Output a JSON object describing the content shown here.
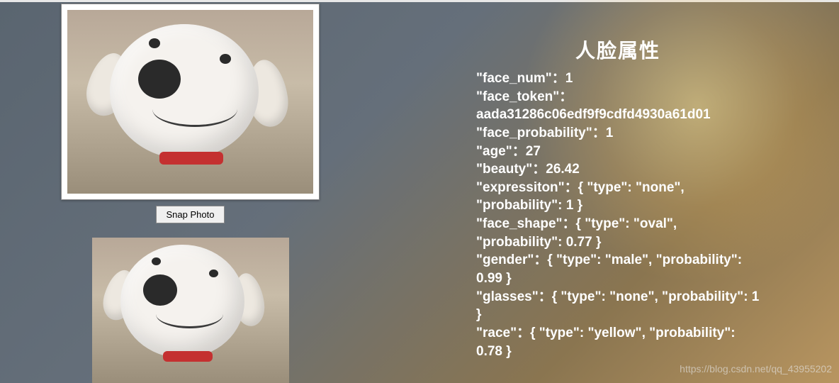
{
  "button": {
    "snap_label": "Snap Photo"
  },
  "attributes": {
    "title": "人脸属性",
    "lines": [
      "\"face_num\"：1",
      "\"face_token\"：",
      "aada31286c06edf9f9cdfd4930a61d01",
      "\"face_probability\"：1",
      "\"age\"：27",
      "\"beauty\"：26.42",
      "\"expressiton\"：{ \"type\": \"none\", \"probability\": 1 }",
      "\"face_shape\"：{ \"type\": \"oval\", \"probability\": 0.77 }",
      "\"gender\"：{ \"type\": \"male\", \"probability\": 0.99 }",
      "\"glasses\"：{ \"type\": \"none\", \"probability\": 1 }",
      "\"race\"：{ \"type\": \"yellow\", \"probability\": 0.78 }"
    ]
  },
  "face_result": {
    "face_num": 1,
    "face_token": "aada31286c06edf9f9cdfd4930a61d01",
    "face_probability": 1,
    "age": 27,
    "beauty": 26.42,
    "expressiton": {
      "type": "none",
      "probability": 1
    },
    "face_shape": {
      "type": "oval",
      "probability": 0.77
    },
    "gender": {
      "type": "male",
      "probability": 0.99
    },
    "glasses": {
      "type": "none",
      "probability": 1
    },
    "race": {
      "type": "yellow",
      "probability": 0.78
    }
  },
  "watermark": "https://blog.csdn.net/qq_43955202"
}
